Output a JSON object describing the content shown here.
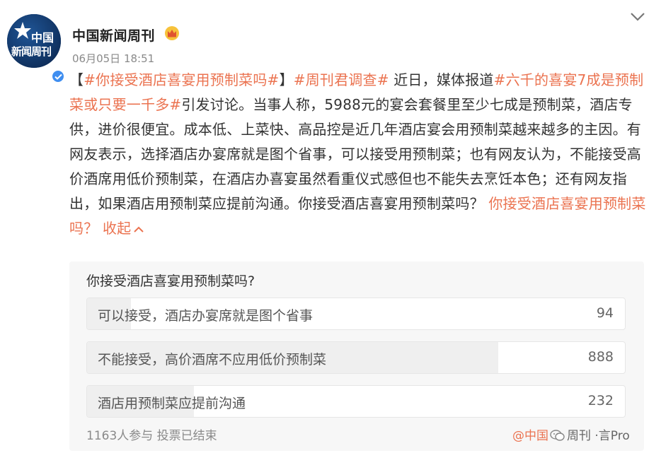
{
  "colors": {
    "accent": "#eb7350",
    "avatar_bg": "#123a6e",
    "verified": "#3f8ef0",
    "poll_bg": "#f7f7f7",
    "bar_fill": "#efefef"
  },
  "author": {
    "avatar_text_line1": "中国",
    "avatar_text_line2": "新闻周刊",
    "name": "中国新闻周刊",
    "badge_icon": "crown-icon",
    "verified_icon": "verified-check-icon",
    "time": "06月05日 18:51"
  },
  "post": {
    "seg1": "【",
    "tag1": "#你接受酒店喜宴用预制菜吗#",
    "seg2": "】",
    "tag2": "#周刊君调查#",
    "seg3": " 近日，媒体报道",
    "tag3": "#六千的喜宴7成是预制菜或只要一千多#",
    "seg4": "引发讨论。当事人称，5988元的宴会套餐里至少七成是预制菜，酒店专供，进价很便宜。成本低、上菜快、高品控是近几年酒店宴会用预制菜越来越多的主因。有网友表示，选择酒店办宴席就是图个省事，可以接受用预制菜；也有网友认为，不能接受高价酒席用低价预制菜，在酒店办喜宴虽然看重仪式感但也不能失去烹饪本色；还有网友指出，如果酒店用预制菜应提前沟通。你接受酒店喜宴用预制菜吗？ ",
    "link": "你接受酒店喜宴用预制菜吗？",
    "collapse": "收起",
    "collapse_icon": "chevron-up-icon"
  },
  "poll": {
    "question": "你接受酒店喜宴用预制菜吗?",
    "options": [
      {
        "label": "可以接受，酒店办宴席就是图个省事",
        "count": "94",
        "share": 0.081
      },
      {
        "label": "不能接受，高价酒席不应用低价预制菜",
        "count": "888",
        "share": 0.764
      },
      {
        "label": "酒店用预制菜应提前沟通",
        "count": "232",
        "share": 0.199
      }
    ],
    "footer": "1163人参与 投票已结束",
    "watermark_at": "@中国",
    "watermark_icon": "wechat-icon",
    "watermark_rest": "周刊 ·言Pro"
  },
  "top_right_icon": "chevron-down-icon"
}
